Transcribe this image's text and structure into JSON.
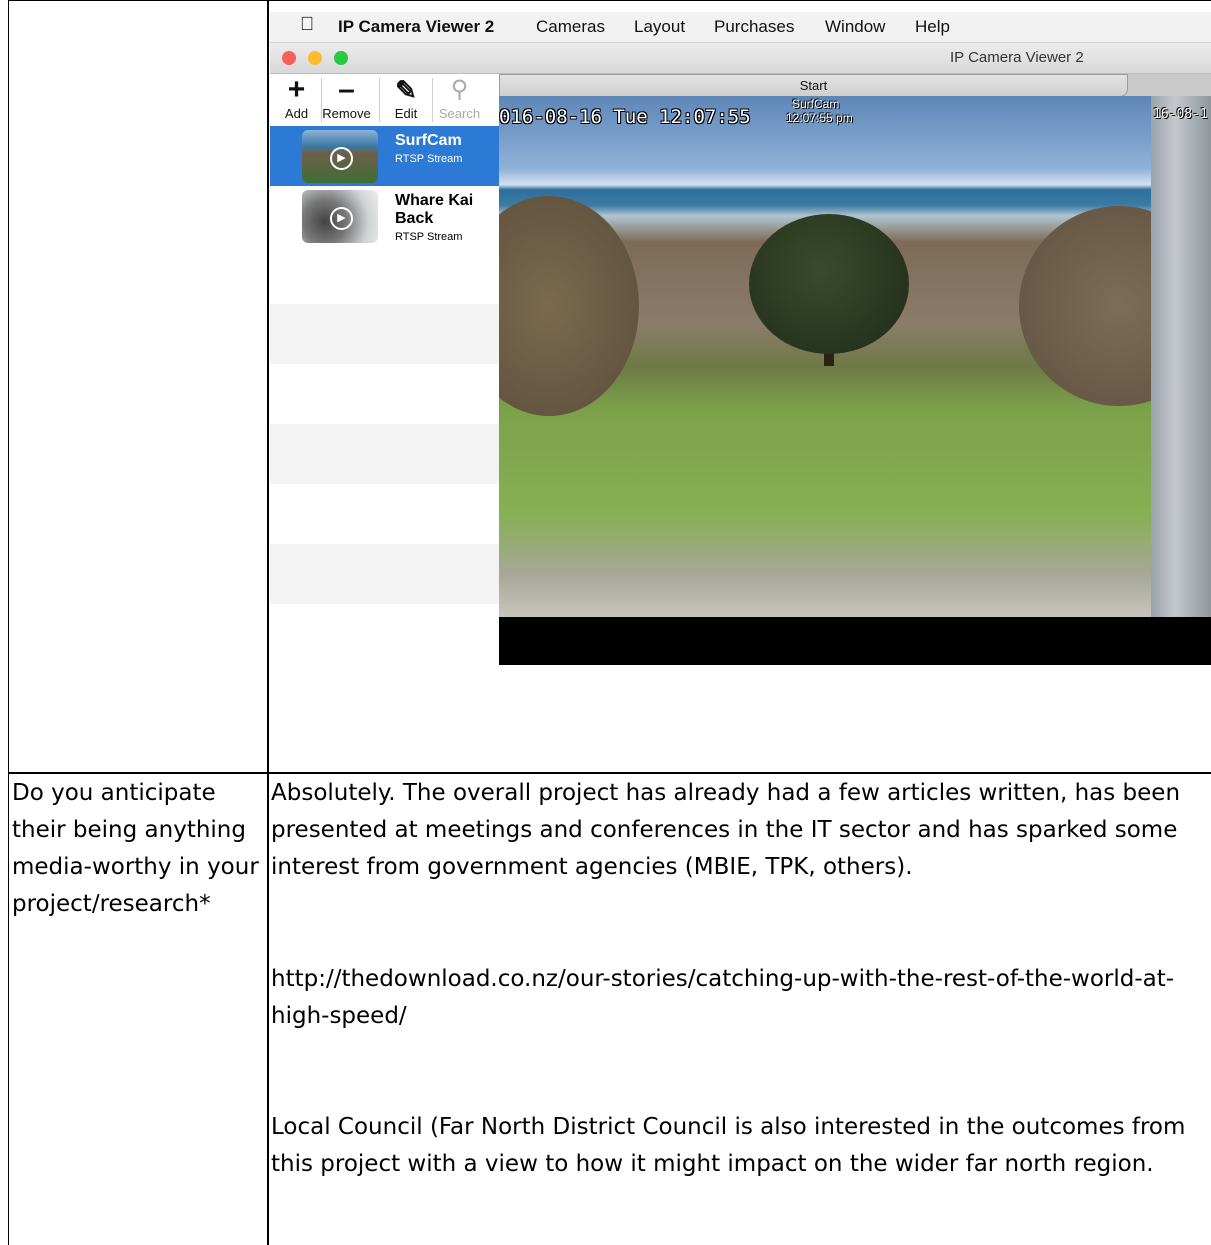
{
  "screenshot": {
    "menubar": {
      "app_name": "IP Camera Viewer 2",
      "menus": [
        "Cameras",
        "Layout",
        "Purchases",
        "Window",
        "Help"
      ]
    },
    "window": {
      "title": "IP Camera Viewer 2",
      "traffic_light_colors": [
        "#fc5f57",
        "#fdbc2e",
        "#28c840"
      ]
    },
    "toolbar": {
      "add_label": "Add",
      "remove_label": "Remove",
      "edit_label": "Edit",
      "search_label": "Search"
    },
    "cameras": [
      {
        "name": "SurfCam",
        "type": "RTSP Stream",
        "selected": true
      },
      {
        "name": "Whare Kai Back",
        "type": "RTSP Stream",
        "selected": false
      }
    ],
    "tab_label": "Start",
    "video": {
      "timestamp": "016-08-16 Tue 12:07:55",
      "overlay_name": "SurfCam",
      "overlay_time": "12:07:55 pm",
      "second_stamp": "16-08-1"
    },
    "selection_color": "#2d7ad6"
  },
  "table": {
    "question": "Do you anticipate their being anything media-worthy in your project/research*",
    "answer_p1": "Absolutely. The overall project has already had a few articles written, has been presented at meetings and conferences in the IT sector and has sparked some interest from government agencies (MBIE, TPK, others).",
    "answer_link": "http://thedownload.co.nz/our-stories/catching-up-with-the-rest-of-the-world-at-high-speed/",
    "answer_p3": "Local Council (Far North District Council is also interested in the outcomes from this project with a view to how it might impact on the wider far north region."
  }
}
